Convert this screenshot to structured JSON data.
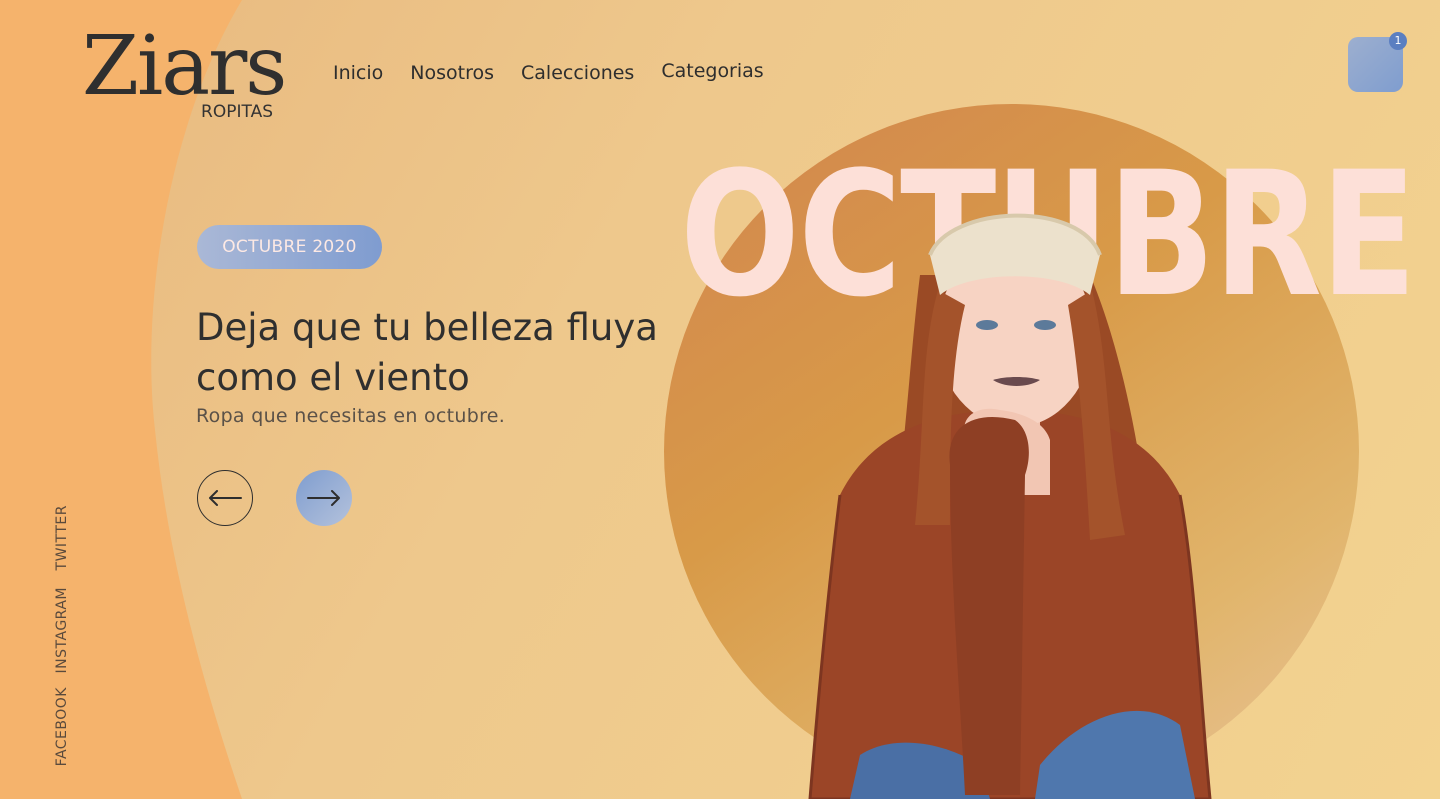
{
  "brand": {
    "name": "Ziars",
    "tagline": "ROPITAS"
  },
  "nav": {
    "items": [
      "Inicio",
      "Nosotros",
      "Calecciones",
      "Categorias"
    ]
  },
  "cart": {
    "count": "1"
  },
  "socials": [
    "FACEBOOK",
    "INSTAGRAM",
    "TWITTER"
  ],
  "hero": {
    "badge": "OCTUBRE 2020",
    "headline_line1": "Deja que tu belleza fluya",
    "headline_line2": "como el viento",
    "subtitle": "Ropa que necesitas en octubre.",
    "big_word": "OCTUBRE"
  },
  "colors": {
    "accent_blue": "#7f9dcf",
    "background": "#eec88c",
    "left_band": "#f5b36c",
    "circle": "#d89a48",
    "big_word": "#fde0d8"
  },
  "icons": {
    "prev": "arrow-left-icon",
    "next": "arrow-right-icon",
    "cart": "cart-icon"
  }
}
